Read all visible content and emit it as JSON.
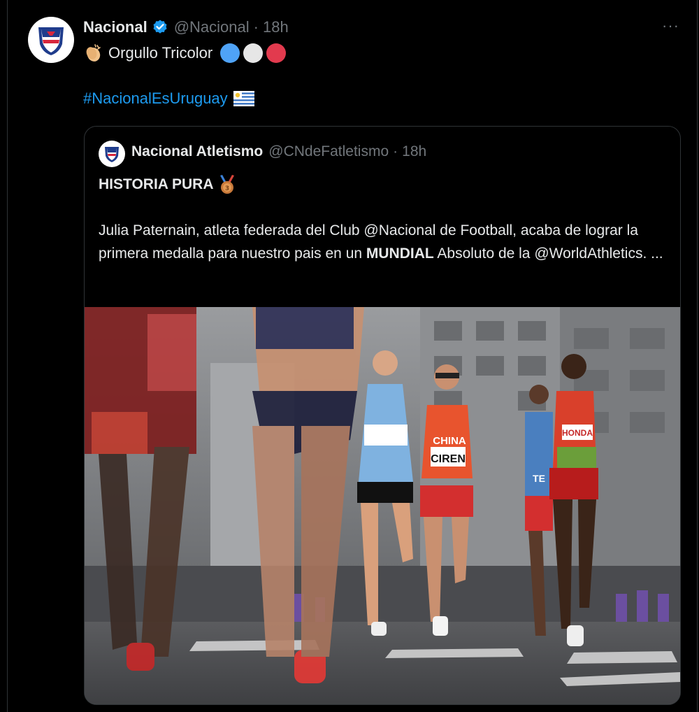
{
  "tweet": {
    "author_name": "Nacional",
    "handle": "@Nacional",
    "dot": "·",
    "time": "18h",
    "more": "···",
    "line1_text": "Orgullo Tricolor",
    "hashtag": "#NacionalEsUruguay",
    "tricolor": [
      "#4fa3f7",
      "#e6e6e6",
      "#e23a4e"
    ]
  },
  "quote": {
    "author_name": "Nacional Atletismo",
    "handle": "@CNdeFatletismo",
    "dot": "·",
    "time": "18h",
    "title": "HISTORIA PURA",
    "body_part1": "Julia Paternain, atleta federada del Club @Nacional de Football, acaba de lograr la primera medalla para nuestro pais en un ",
    "body_bold": "MUNDIAL",
    "body_part2": " Absoluto de la @WorldAthletics. ...",
    "photo_bibs": [
      "CHINA",
      "CIREN",
      "HONDA",
      "TE"
    ]
  },
  "colors": {
    "link": "#1d9bf0",
    "muted": "#71767b",
    "border": "#2f3336",
    "verified": "#1d9bf0"
  }
}
